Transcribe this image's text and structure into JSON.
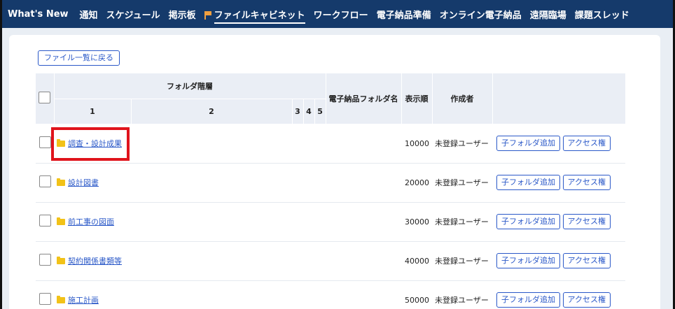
{
  "nav": {
    "items": [
      {
        "label": "What's New"
      },
      {
        "label": "通知"
      },
      {
        "label": "スケジュール"
      },
      {
        "label": "掲示板"
      },
      {
        "label": "ファイルキャビネット",
        "active": true
      },
      {
        "label": "ワークフロー"
      },
      {
        "label": "電子納品準備"
      },
      {
        "label": "オンライン電子納品"
      },
      {
        "label": "遠隔臨場"
      },
      {
        "label": "課題スレッド"
      }
    ]
  },
  "back_button": "ファイル一覧に戻る",
  "table": {
    "header_group": "フォルダ階層",
    "level_headers": [
      "1",
      "2",
      "3",
      "4",
      "5"
    ],
    "col_name": "電子納品フォルダ名",
    "col_order": "表示順",
    "col_creator": "作成者",
    "rows": [
      {
        "folder": "調査・設計成果",
        "order": "10000",
        "creator": "未登録ユーザー"
      },
      {
        "folder": "設計図書",
        "order": "20000",
        "creator": "未登録ユーザー"
      },
      {
        "folder": "前工事の図面",
        "order": "30000",
        "creator": "未登録ユーザー"
      },
      {
        "folder": "契約関係書類等",
        "order": "40000",
        "creator": "未登録ユーザー"
      },
      {
        "folder": "施工計画",
        "order": "50000",
        "creator": "未登録ユーザー"
      }
    ],
    "btn_add_subfolder": "子フォルダ追加",
    "btn_access": "アクセス権"
  },
  "colors": {
    "nav_bg": "#153a6b",
    "accent": "#2a58c8",
    "highlight": "#e0141c"
  }
}
